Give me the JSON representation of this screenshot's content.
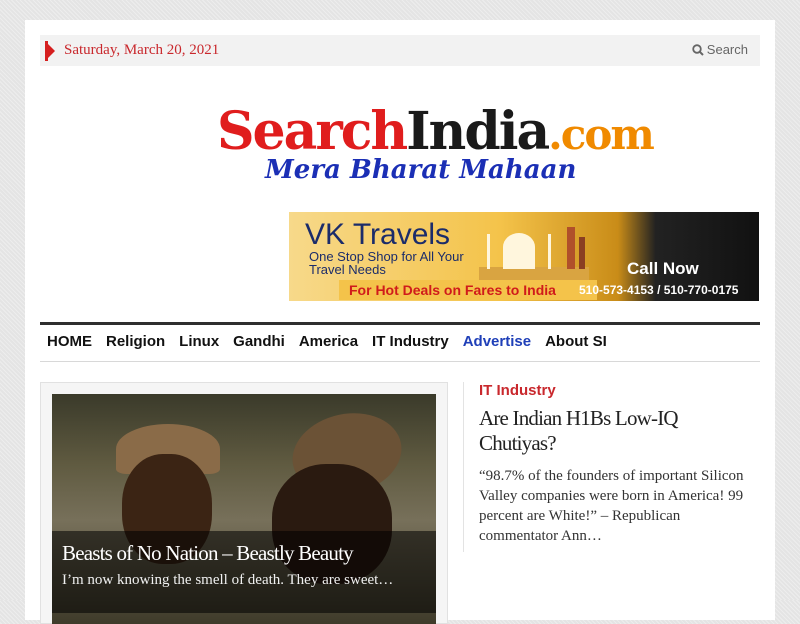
{
  "topbar": {
    "date": "Saturday, March 20, 2021",
    "search_label": "Search"
  },
  "logo": {
    "part_search": "Search",
    "part_india": "India",
    "part_com": ".com",
    "tagline": "Mera Bharat Mahaan"
  },
  "banner": {
    "title": "VK Travels",
    "subtitle": "One Stop Shop for All Your Travel Needs",
    "deal": "For Hot Deals on Fares to India",
    "cta": "Call Now",
    "phones": "510-573-4153 / 510-770-0175"
  },
  "nav": {
    "items": [
      {
        "label": "HOME"
      },
      {
        "label": "Religion"
      },
      {
        "label": "Linux"
      },
      {
        "label": "Gandhi"
      },
      {
        "label": "America"
      },
      {
        "label": "IT Industry"
      },
      {
        "label": "Advertise"
      },
      {
        "label": "About SI"
      }
    ]
  },
  "feature": {
    "title": "Beasts of No Nation – Beastly Beauty",
    "excerpt": "I’m now knowing the smell of death. They are sweet…"
  },
  "side_post": {
    "category": "IT Industry",
    "title": "Are Indian H1Bs Low-IQ Chutiyas?",
    "excerpt": "“98.7% of the founders of important Silicon Valley companies were born in America! 99 percent are White!” – Republican commentator Ann…"
  },
  "colors": {
    "accent_red": "#c9282d",
    "nav_accent_blue": "#1f3fb8"
  }
}
